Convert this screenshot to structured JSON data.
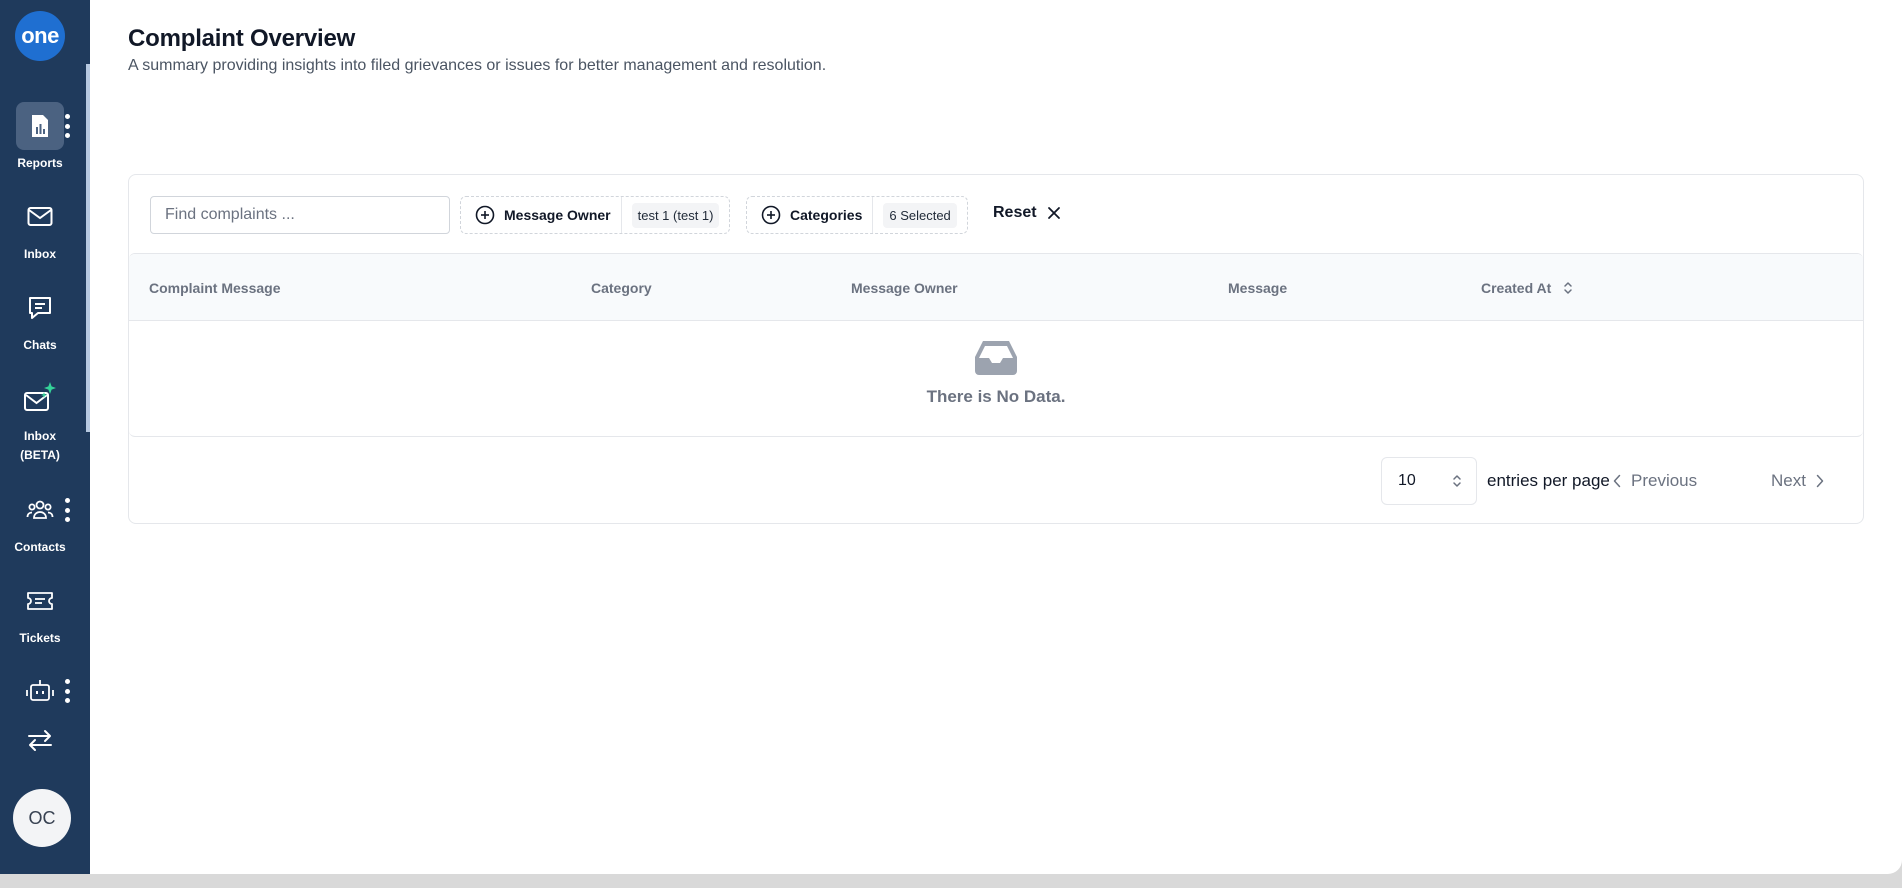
{
  "sidebar": {
    "logo_text": "one",
    "items": [
      {
        "label": "Reports",
        "icon": "report-chart-icon"
      },
      {
        "label": "Inbox",
        "icon": "mail-icon"
      },
      {
        "label": "Chats",
        "icon": "chat-bubble-icon"
      },
      {
        "label": "Inbox\n(BETA)",
        "label_line1": "Inbox",
        "label_line2": "(BETA)",
        "icon": "mail-sparkle-icon"
      },
      {
        "label": "Contacts",
        "icon": "users-icon"
      },
      {
        "label": "Tickets",
        "icon": "ticket-icon"
      },
      {
        "label": "",
        "icon": "robot-icon"
      },
      {
        "label": "",
        "icon": "switch-arrows-icon"
      }
    ],
    "avatar_initials": "OC",
    "colors": {
      "background": "#1f3a5c",
      "active": "#4b6281",
      "logo": "#1f6fd1",
      "sparkle": "#34d399"
    }
  },
  "header": {
    "title": "Complaint Overview",
    "subtitle": "A summary providing insights into filed grievances or issues for better management and resolution."
  },
  "toolbar": {
    "search_placeholder": "Find complaints ...",
    "filters": [
      {
        "label": "Message Owner",
        "value": "test 1 (test 1)"
      },
      {
        "label": "Categories",
        "value": "6 Selected"
      }
    ],
    "reset_label": "Reset"
  },
  "table": {
    "columns": [
      "Complaint Message",
      "Category",
      "Message Owner",
      "Message",
      "Created At"
    ],
    "empty_text": "There is No Data."
  },
  "pagination": {
    "page_size": "10",
    "entries_label": "entries per page",
    "previous_label": "Previous",
    "next_label": "Next"
  }
}
